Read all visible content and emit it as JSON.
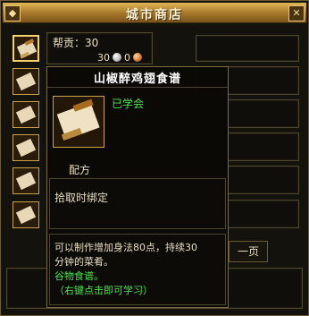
{
  "window": {
    "title": "城市商店",
    "left_icon": "gem-icon",
    "close_icon": "close-icon"
  },
  "panel": {
    "contribution_label": "帮贡：30",
    "silver_amount": "30",
    "copper_amount": "0"
  },
  "item_slots": [
    {
      "name": "recipe-scroll-icon"
    },
    {
      "name": "recipe-scroll-icon"
    },
    {
      "name": "recipe-scroll-icon"
    },
    {
      "name": "recipe-scroll-icon"
    },
    {
      "name": "recipe-scroll-icon"
    },
    {
      "name": "recipe-scroll-icon"
    }
  ],
  "tooltip": {
    "item_name": "山椒醉鸡翅食谱",
    "learned_status": "已学会",
    "item_type": "配方",
    "bind_rule": "拾取时绑定",
    "description_line1": "可以制作增加身法80点，持续30",
    "description_line2": "分钟的菜肴。",
    "category": "谷物食谱。",
    "hint": "（右键点击即可学习）"
  },
  "pager": {
    "next_page_label": "一页"
  },
  "colors": {
    "title_gold": "#c49238",
    "learned_green": "#4ce44c",
    "border": "#6b5a32"
  }
}
